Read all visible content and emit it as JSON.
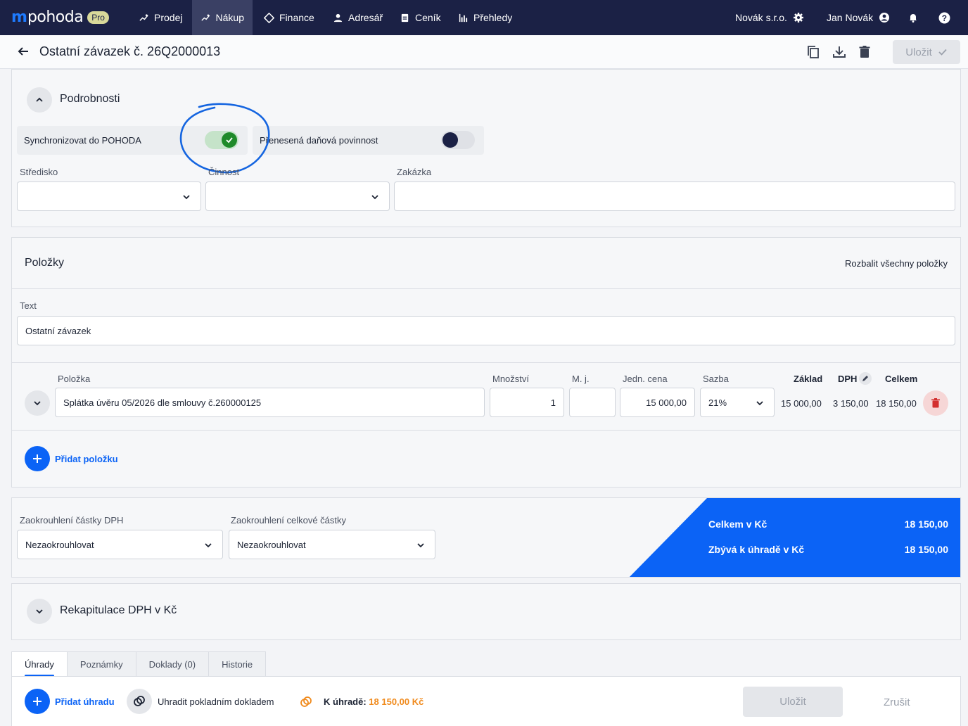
{
  "nav": {
    "logo_mark": "m",
    "logo_word": "pohoda",
    "logo_badge": "Pro",
    "items": [
      {
        "label": "Prodej"
      },
      {
        "label": "Nákup"
      },
      {
        "label": "Finance"
      },
      {
        "label": "Adresář"
      },
      {
        "label": "Ceník"
      },
      {
        "label": "Přehledy"
      }
    ],
    "company": "Novák s.r.o.",
    "user": "Jan Novák"
  },
  "header": {
    "title": "Ostatní závazek č. 26Q2000013",
    "save_label": "Uložit"
  },
  "details": {
    "title": "Podrobnosti",
    "sync_label": "Synchronizovat do POHODA",
    "sync_on": true,
    "reverse_charge_label": "Přenesená daňová povinnost",
    "reverse_charge_on": false,
    "center_label": "Středisko",
    "center_value": "",
    "activity_label": "Činnost",
    "activity_value": "",
    "order_label": "Zakázka",
    "order_value": ""
  },
  "items": {
    "title": "Položky",
    "expand_all": "Rozbalit všechny položky",
    "text_label": "Text",
    "text_value": "Ostatní závazek",
    "columns": {
      "item": "Položka",
      "quantity": "Množství",
      "unit": "M. j.",
      "unit_price": "Jedn. cena",
      "rate": "Sazba",
      "base": "Základ",
      "vat": "DPH",
      "total": "Celkem"
    },
    "rows": [
      {
        "item": "Splátka úvěru 05/2026 dle smlouvy č.260000125",
        "quantity": "1",
        "unit": "",
        "unit_price": "15 000,00",
        "rate": "21%",
        "base": "15 000,00",
        "vat": "3 150,00",
        "total": "18 150,00"
      }
    ],
    "add_label": "Přidat položku"
  },
  "rounding": {
    "vat_label": "Zaokrouhlení částky DPH",
    "vat_value": "Nezaokrouhlovat",
    "total_label": "Zaokrouhlení celkové částky",
    "total_value": "Nezaokrouhlovat"
  },
  "summary": {
    "total_label": "Celkem v Kč",
    "total_value": "18 150,00",
    "remaining_label": "Zbývá k úhradě v Kč",
    "remaining_value": "18 150,00",
    "accent": "#0b63f6"
  },
  "vat_recap": {
    "title": "Rekapitulace DPH v Kč"
  },
  "tabs": [
    {
      "label": "Úhrady",
      "active": true
    },
    {
      "label": "Poznámky",
      "active": false
    },
    {
      "label": "Doklady (0)",
      "active": false
    },
    {
      "label": "Historie",
      "active": false
    }
  ],
  "payments": {
    "add_label": "Přidat úhradu",
    "cash_label": "Uhradit pokladním dokladem",
    "due_label": "K úhradě:",
    "due_value": "18 150,00 Kč",
    "save_label": "Uložit",
    "cancel_label": "Zrušit"
  }
}
